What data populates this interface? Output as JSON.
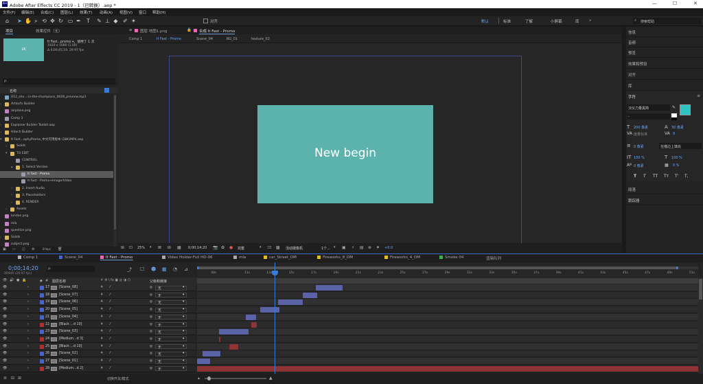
{
  "app": {
    "title": "Adobe After Effects CC 2019 - 1（已转换）.aep *",
    "logo": "Ae",
    "win": [
      "—",
      "☐",
      "✕"
    ]
  },
  "menu": [
    "文件(F)",
    "编辑(E)",
    "合成(C)",
    "图层(L)",
    "效果(T)",
    "动画(A)",
    "视图(V)",
    "窗口",
    "帮助(H)"
  ],
  "toolbar": {
    "align_label": "对齐",
    "workspaces": [
      "默认",
      "标准",
      "了解",
      "小屏幕",
      "库"
    ],
    "active_ws": 0,
    "more": "»",
    "search_placeholder": "搜索帮助"
  },
  "project": {
    "tabs": [
      "项目",
      "效果控件（无）"
    ],
    "thumb_text": "LK",
    "name": "It Fast...promo ▾，使用了 1 次",
    "info1": "1920 x 1080 (1.00)",
    "info2": "Δ 0;00;45;19, 29.97 fps",
    "search": "ρ.",
    "col_name": "名称",
    "footer": "8 bpc",
    "items": [
      {
        "t": "U12_sho...-in-the-champions_0028_preview.mp3",
        "lvl": 0,
        "type": "audio"
      },
      {
        "t": "Artlocfx Builder",
        "lvl": 0,
        "type": "folder"
      },
      {
        "t": "airplane.png",
        "lvl": 0,
        "type": "image"
      },
      {
        "t": "Comp 1",
        "lvl": 0,
        "type": "comp"
      },
      {
        "t": "Explainer Builder Toolkit.aep",
        "lvl": 0,
        "type": "folder"
      },
      {
        "t": "Hitech Builder",
        "lvl": 0,
        "type": "folder"
      },
      {
        "t": "It Fast...aphyPromo_中文可用版本 (28K)MP4.aep",
        "lvl": 0,
        "type": "folder",
        "open": true
      },
      {
        "t": "Solids",
        "lvl": 1,
        "type": "folder"
      },
      {
        "t": "TO EDIT",
        "lvl": 1,
        "type": "folder",
        "open": true
      },
      {
        "t": "CONTROL",
        "lvl": 2,
        "type": "comp"
      },
      {
        "t": "1. Select Version",
        "lvl": 2,
        "type": "folder",
        "open": true
      },
      {
        "t": "It Fast - Promo",
        "lvl": 3,
        "type": "comp",
        "sel": true
      },
      {
        "t": "It Fast - Promo+Image/Video",
        "lvl": 3,
        "type": "comp"
      },
      {
        "t": "2. Insert Audio",
        "lvl": 2,
        "type": "folder"
      },
      {
        "t": "3. Placeholders",
        "lvl": 2,
        "type": "folder"
      },
      {
        "t": "4. RENDER",
        "lvl": 2,
        "type": "folder"
      },
      {
        "t": "Assets",
        "lvl": 1,
        "type": "folder"
      },
      {
        "t": "london.png",
        "lvl": 0,
        "type": "image"
      },
      {
        "t": "mla",
        "lvl": 0,
        "type": "image"
      },
      {
        "t": "question.png",
        "lvl": 0,
        "type": "image"
      },
      {
        "t": "Solids",
        "lvl": 0,
        "type": "folder"
      },
      {
        "t": "subject.png",
        "lvl": 0,
        "type": "image"
      }
    ]
  },
  "viewer": {
    "top_tabs": [
      {
        "t": "图层 地图1.png",
        "c": "#e86ab5"
      },
      {
        "t": "合成 It Fast - Promo",
        "c": "#e86ab5",
        "act": true
      }
    ],
    "sub_tabs": [
      "Comp 1",
      "It Fast - Promo",
      "Scene_04",
      "BG_01",
      "texture_02"
    ],
    "sub_act": 1,
    "canvas_text": "New begin",
    "canvas_color": "#5cb3ae",
    "bottom": {
      "zoom": "25%",
      "time": "0;00;14;20",
      "res": "完整",
      "camera": "活动摄像机",
      "views": "1个...",
      "exposure": "+0.0"
    }
  },
  "right": {
    "panels": [
      "信息",
      "音频",
      "预览",
      "效果和预设",
      "对齐",
      "库"
    ],
    "char_title": "字符",
    "font": "汉仪力量黑简",
    "font_style": "-",
    "size": "200 像素",
    "leading": "30 像素",
    "kerning": "度量标准",
    "tracking": "0",
    "stroke_w": "0 像素",
    "stroke_mode": "在描边上填充",
    "vscale": "100 %",
    "hscale": "100 %",
    "baseline": "0 像素",
    "tsume": "0 %",
    "styles": [
      "T",
      "T",
      "TT",
      "Tт",
      "T'",
      "T,"
    ],
    "bottom_panels": [
      "段落",
      "跟踪器"
    ],
    "fill_color": "#2ec3c3"
  },
  "timeline": {
    "tabs": [
      {
        "t": "Comp 1",
        "c": "#b7b7b7"
      },
      {
        "t": "Scene_04",
        "c": "#4a64c8"
      },
      {
        "t": "It Fast - Promo",
        "c": "#e86ab5",
        "act": true
      },
      {
        "t": "Video Holder-Full HD-06",
        "c": "#aaaaaa"
      },
      {
        "t": "mla",
        "c": "#aaaaaa"
      },
      {
        "t": "car_Street_DM",
        "c": "#e0c020"
      },
      {
        "t": "Fireworks_8_DM",
        "c": "#e0c020"
      },
      {
        "t": "Fireworks_4_DM",
        "c": "#e0c020"
      },
      {
        "t": "Smoke 04",
        "c": "#3fb04f"
      },
      {
        "t": "渲染队列",
        "c": ""
      }
    ],
    "timecode": "0;00;14;20",
    "fps_line": "00440 (29.97 fps)",
    "search": "ρ.",
    "col_hash": "#",
    "col_name": "图层名称",
    "col_parent": "父级和链接",
    "footer": "切换开关/模式",
    "ticks": [
      "08s",
      "11s",
      "13s",
      "15s",
      "17s",
      "19s",
      "21s",
      "23s",
      "25s",
      "27s",
      "29s",
      "31s",
      "33s",
      "35s",
      "37s",
      "39s",
      "41s",
      "43s",
      "45s",
      "47s",
      "49s",
      "51s"
    ],
    "layers": [
      {
        "n": "17",
        "name": "[Scene_08]",
        "lbl": "#4a64c8",
        "parent": "无",
        "bar": {
          "s": 17.2,
          "e": 19.6,
          "c": "#5c62a8"
        }
      },
      {
        "n": "18",
        "name": "[Scene_07]",
        "lbl": "#4a64c8",
        "parent": "无",
        "bar": {
          "s": 16.0,
          "e": 17.3,
          "c": "#5c62a8"
        }
      },
      {
        "n": "19",
        "name": "[Scene_06]",
        "lbl": "#4a64c8",
        "parent": "无",
        "bar": {
          "s": 13.8,
          "e": 16.0,
          "c": "#5c62a8"
        }
      },
      {
        "n": "20",
        "name": "[Scene_05]",
        "lbl": "#4a64c8",
        "parent": "无",
        "bar": {
          "s": 12.2,
          "e": 13.9,
          "c": "#5c62a8"
        }
      },
      {
        "n": "21",
        "name": "[Scene_04]",
        "lbl": "#4a64c8",
        "parent": "无",
        "bar": {
          "s": 10.9,
          "e": 11.8,
          "c": "#5c62a8"
        }
      },
      {
        "n": "22",
        "name": "[Black ...d 10]",
        "lbl": "#b03030",
        "parent": "无",
        "bar": {
          "s": 11.4,
          "e": 11.9,
          "c": "#8e3434"
        }
      },
      {
        "n": "23",
        "name": "[Scene_03]",
        "lbl": "#4a64c8",
        "parent": "无",
        "bar": {
          "s": 8.5,
          "e": 11.1,
          "c": "#5c62a8"
        }
      },
      {
        "n": "24",
        "name": "[Medium...d 3]",
        "lbl": "#b03030",
        "parent": "无",
        "bar": {
          "s": 8.5,
          "e": 8.6,
          "c": "#8e3434"
        }
      },
      {
        "n": "25",
        "name": "[Black ...d 10]",
        "lbl": "#b03030",
        "parent": "无",
        "bar": {
          "s": 9.4,
          "e": 10.2,
          "c": "#8e3434"
        }
      },
      {
        "n": "26",
        "name": "[Scene_02]",
        "lbl": "#4a64c8",
        "parent": "无",
        "bar": {
          "s": 7.0,
          "e": 8.6,
          "c": "#5c62a8"
        }
      },
      {
        "n": "27",
        "name": "[Scene_01]",
        "lbl": "#4a64c8",
        "parent": "无",
        "bar": {
          "s": 5.6,
          "e": 7.7,
          "c": "#5c62a8"
        }
      },
      {
        "n": "28",
        "name": "[Medium...d 2]",
        "lbl": "#b03030",
        "parent": "无",
        "bar": {
          "s": 5.6,
          "e": 52,
          "c": "#8e3434"
        }
      }
    ]
  }
}
